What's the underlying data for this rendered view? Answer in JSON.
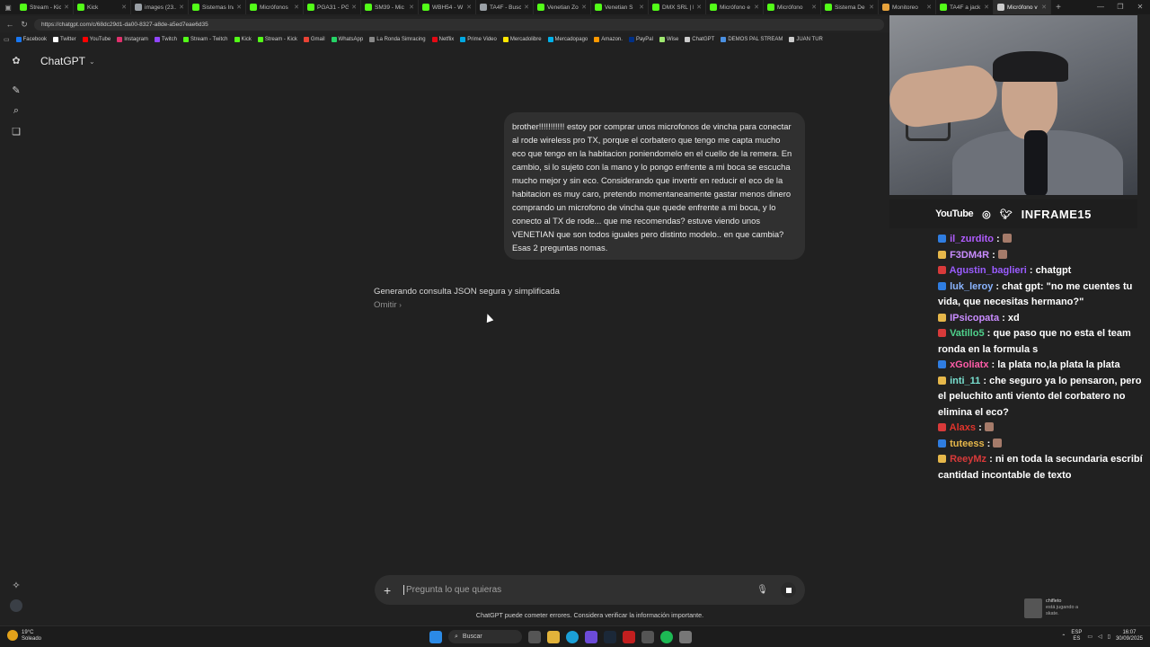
{
  "browser": {
    "tabs": [
      {
        "label": "Stream - Kic",
        "color": "#53fc18"
      },
      {
        "label": "Kick",
        "color": "#53fc18"
      },
      {
        "label": "images (23...",
        "color": "#9aa0a6"
      },
      {
        "label": "Sistemas Ina",
        "color": "#53fc18"
      },
      {
        "label": "Micrófonos",
        "color": "#53fc18"
      },
      {
        "label": "PGA31 - PG",
        "color": "#53fc18"
      },
      {
        "label": "SM39 - Mic",
        "color": "#53fc18"
      },
      {
        "label": "WBH54 - W",
        "color": "#53fc18"
      },
      {
        "label": "TA4F - Busc",
        "color": "#9aa0a6"
      },
      {
        "label": "Venetian Zo",
        "color": "#53fc18"
      },
      {
        "label": "Venetian S",
        "color": "#53fc18"
      },
      {
        "label": "DMX SRL | F",
        "color": "#53fc18"
      },
      {
        "label": "Micrófono e",
        "color": "#53fc18"
      },
      {
        "label": "Micrófono",
        "color": "#53fc18"
      },
      {
        "label": "Sistema De",
        "color": "#53fc18"
      },
      {
        "label": "Monitoreo",
        "color": "#e8a33c"
      },
      {
        "label": "TA4F a jack",
        "color": "#53fc18"
      },
      {
        "label": "Micrófono v",
        "color": "#cccccc",
        "active": true
      }
    ],
    "new_tab": "+",
    "url": "https://chatgpt.com/c/68dc29d1-da00-8327-a8de-a5ed7eae6d35",
    "bookmarks": [
      {
        "label": "Facebook",
        "color": "#1877f2"
      },
      {
        "label": "Twitter",
        "color": "#ffffff"
      },
      {
        "label": "YouTube",
        "color": "#ff0000"
      },
      {
        "label": "Instagram",
        "color": "#e1306c"
      },
      {
        "label": "Twitch",
        "color": "#9146ff"
      },
      {
        "label": "Stream - Twitch",
        "color": "#53fc18"
      },
      {
        "label": "Kick",
        "color": "#53fc18"
      },
      {
        "label": "Stream - Kick",
        "color": "#53fc18"
      },
      {
        "label": "Gmail",
        "color": "#ea4335"
      },
      {
        "label": "WhatsApp",
        "color": "#25d366"
      },
      {
        "label": "La Ronda Simracing",
        "color": "#888888"
      },
      {
        "label": "Netflix",
        "color": "#e50914"
      },
      {
        "label": "Prime Video",
        "color": "#00a8e1"
      },
      {
        "label": "Mercadolibre",
        "color": "#ffe600"
      },
      {
        "label": "Mercadopago",
        "color": "#00b1ea"
      },
      {
        "label": "Amazon.",
        "color": "#ff9900"
      },
      {
        "label": "PayPal",
        "color": "#003087"
      },
      {
        "label": "Wise",
        "color": "#9fe870"
      },
      {
        "label": "ChatGPT",
        "color": "#cccccc"
      },
      {
        "label": "DEMOS PAL STREAM",
        "color": "#4a90e2"
      },
      {
        "label": "JUAN TUR",
        "color": "#cccccc"
      }
    ]
  },
  "chatgpt": {
    "brand": "ChatGPT",
    "user_message": "brother!!!!!!!!!!! estoy por comprar unos microfonos de vincha para conectar al rode wireless pro TX, porque el corbatero que tengo me capta mucho eco que tengo en la habitacion poniendomelo en el cuello de la remera. En cambio, si lo sujeto con la mano y lo pongo enfrente a mi boca se escucha mucho mejor  y sin eco. Considerando que invertir en reducir el eco de la habitacion es muy caro, pretendo momentaneamente gastar menos dinero comprando un microfono de vincha que quede enfrente a mi boca, y lo conecto al TX de rode... que me recomendas? estuve viendo unos VENETIAN que son todos iguales pero distinto modelo.. en que cambia? Esas 2 preguntas nomas.",
    "thinking_status": "Generando consulta JSON segura y simplificada",
    "skip_label": "Omitir",
    "composer_placeholder": "Pregunta lo que quieras",
    "disclaimer": "ChatGPT puede cometer errores. Considera verificar la información importante."
  },
  "stream": {
    "socials_youtube": "YouTube",
    "channel_name": "INFRAME15",
    "chat": [
      {
        "user": "il_zurdito",
        "color": "#b05cff",
        "text": ""
      },
      {
        "user": "F3DM4R",
        "color": "#c98cff",
        "text": ""
      },
      {
        "user": "Agustin_baglieri",
        "color": "#9a5cff",
        "text": "chatgpt"
      },
      {
        "user": "luk_leroy",
        "color": "#8ab4ff",
        "text": "chat gpt: \"no me cuentes tu vida, que necesitas hermano?\""
      },
      {
        "user": "IPsicopata",
        "color": "#c98cff",
        "text": "xd"
      },
      {
        "user": "Vatillo5",
        "color": "#4fd18b",
        "text": "que paso que no esta el team ronda en la formula s"
      },
      {
        "user": "xGoliatx",
        "color": "#ff5ca8",
        "text": "la plata no,la plata la plata"
      },
      {
        "user": "inti_11",
        "color": "#79e0d0",
        "text": "che seguro ya lo pensaron, pero el peluchito anti viento del corbatero no elimina el eco?"
      },
      {
        "user": "Alaxs",
        "color": "#e0342c",
        "text": ""
      },
      {
        "user": "tuteess",
        "color": "#e6b74a",
        "text": ""
      },
      {
        "user": "ReeyMz",
        "color": "#d83a3a",
        "text": "ni en toda la secundaria escribí cantidad incontable de texto"
      }
    ],
    "notification_user": "chifleto",
    "notification_text": "está jugando a",
    "notification_game": "skate."
  },
  "taskbar": {
    "temperature": "19°C",
    "weather": "Soleado",
    "search_label": "Buscar",
    "lang_top": "ESP",
    "lang_bottom": "ES",
    "time": "16:07",
    "date": "30/09/2025"
  }
}
